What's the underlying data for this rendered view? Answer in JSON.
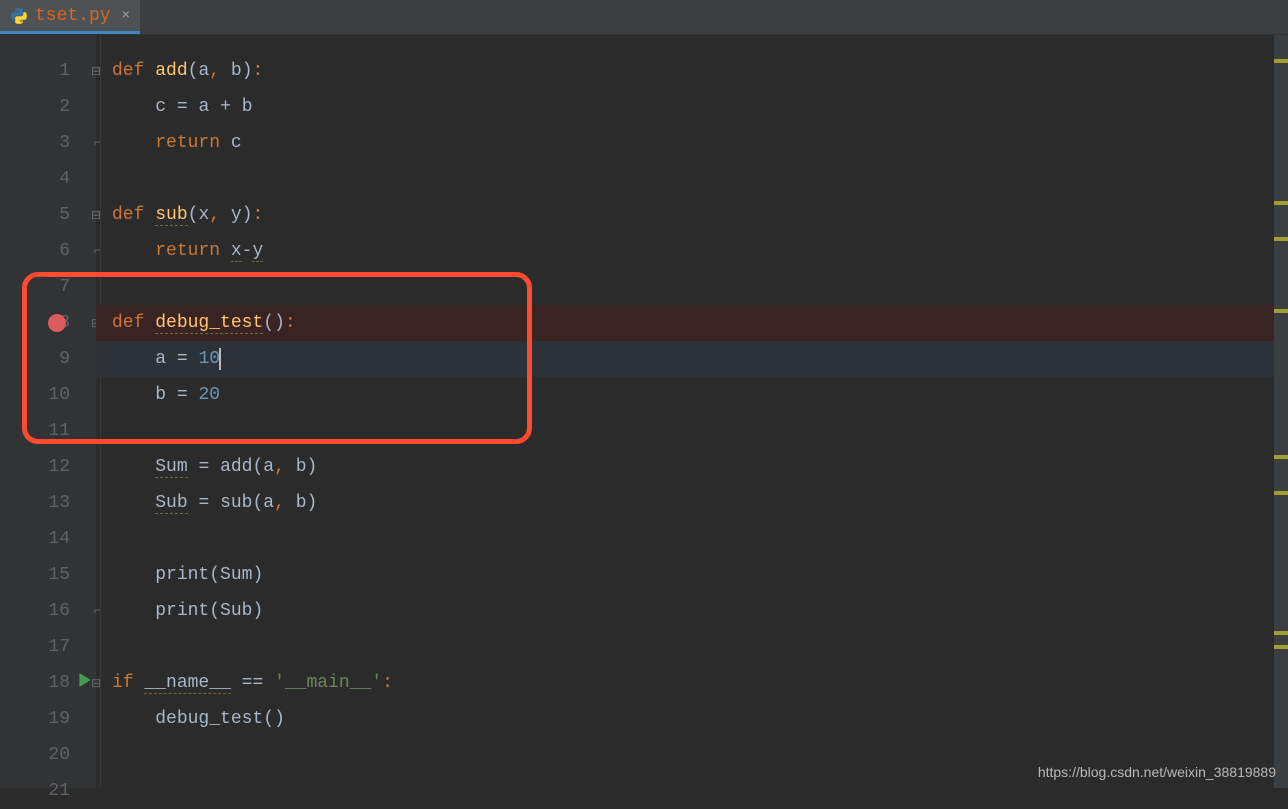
{
  "tab": {
    "filename": "tset.py",
    "close": "×"
  },
  "lines": {
    "1": "1",
    "2": "2",
    "3": "3",
    "4": "4",
    "5": "5",
    "6": "6",
    "7": "7",
    "8": "8",
    "9": "9",
    "10": "10",
    "11": "11",
    "12": "12",
    "13": "13",
    "14": "14",
    "15": "15",
    "16": "16",
    "17": "17",
    "18": "18",
    "19": "19",
    "20": "20",
    "21": "21"
  },
  "tok": {
    "def": "def",
    "add": "add",
    "sub": "sub",
    "debug_test": "debug_test",
    "return": "return",
    "if": "if",
    "name": "__name__",
    "main": "'__main__'",
    "a": "a",
    "b": "b",
    "c": "c",
    "x": "x",
    "y": "y",
    "Sum": "Sum",
    "Sub": "Sub",
    "print": "print",
    "eq": "=",
    "eqeq": "==",
    "plus": "+",
    "minus": "-",
    "n10": "10",
    "n20": "20",
    "lp": "(",
    "rp": ")",
    "comma": ",",
    "colon": ":",
    "sp": " ",
    "sp4": "    ",
    "sp8": "        "
  },
  "watermark": "https://blog.csdn.net/weixin_38819889"
}
